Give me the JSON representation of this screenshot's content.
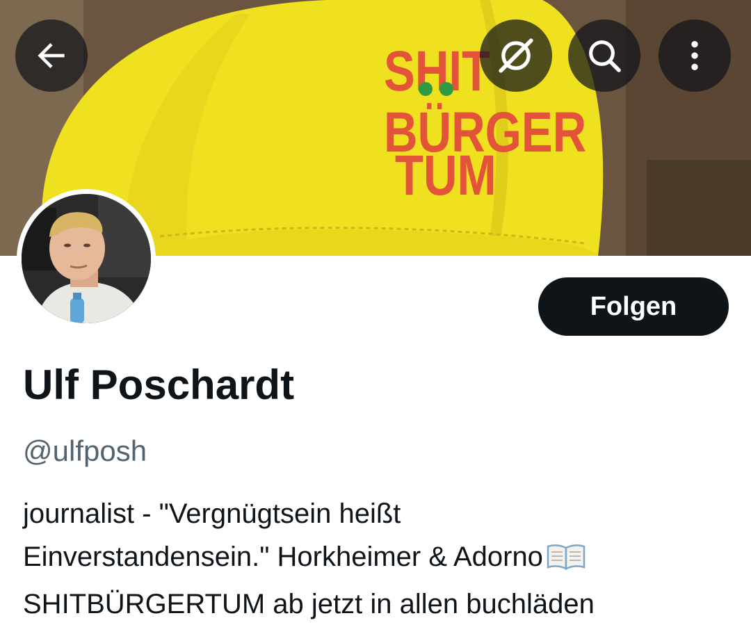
{
  "header": {
    "back_icon": "arrow-left-icon",
    "grok_icon": "grok-icon",
    "search_icon": "search-icon",
    "more_icon": "more-vertical-icon"
  },
  "banner": {
    "cap_text_line1": "SHIT",
    "cap_text_line2": "BÜRGER",
    "cap_text_line3": "TUM",
    "cap_color": "#f2e21b",
    "embroidery_color": "#e2533a"
  },
  "profile": {
    "follow_label": "Folgen",
    "display_name": "Ulf Poschardt",
    "handle": "@ulfposh",
    "bio_line1": "journalist - \"Vergnügtsein heißt",
    "bio_line2": "Einverstandensein.\" Horkheimer & Adorno",
    "bio_line2_emoji": "open-book-icon",
    "bio_line3": "SHITBÜRGERTUM ab jetzt in allen buchläden"
  },
  "colors": {
    "text_primary": "#0f1419",
    "text_secondary": "#536471",
    "button_bg": "#0f1419",
    "button_text": "#ffffff"
  }
}
